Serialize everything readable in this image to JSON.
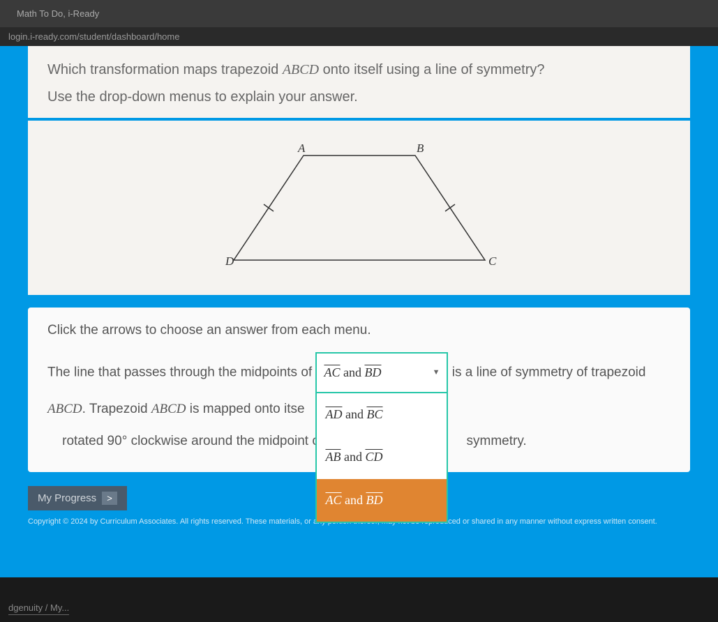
{
  "browser": {
    "tab_title": "Math To Do, i-Ready",
    "url": "login.i-ready.com/student/dashboard/home"
  },
  "question": {
    "line1_prefix": "Which transformation maps trapezoid ",
    "line1_math": "ABCD",
    "line1_suffix": " onto itself using a line of symmetry?",
    "line2": "Use the drop-down menus to explain your answer."
  },
  "diagram": {
    "labels": {
      "A": "A",
      "B": "B",
      "C": "C",
      "D": "D"
    }
  },
  "answer": {
    "instruction": "Click the arrows to choose an answer from each menu.",
    "text_part1": "The line that passes through the midpoints of ",
    "text_part2": " is a line of symmetry of trapezoid",
    "text_part3_math": "ABCD",
    "text_part3_suffix": ". Trapezoid ",
    "text_part3_math2": "ABCD",
    "text_part3_cont": " is mapped onto itse",
    "text_part4_prefix": "rotated 90° clockwise around the midpoint o",
    "text_part4_suffix": "symmetry.",
    "dropdown": {
      "selected": "AC and BD",
      "options": [
        {
          "seg1": "AD",
          "conj": " and ",
          "seg2": "BC",
          "highlighted": false
        },
        {
          "seg1": "AB",
          "conj": " and ",
          "seg2": "CD",
          "highlighted": false
        },
        {
          "seg1": "AC",
          "conj": " and ",
          "seg2": "BD",
          "highlighted": true
        }
      ]
    }
  },
  "progress_button": "My Progress",
  "copyright": "Copyright © 2024 by Curriculum Associates. All rights reserved. These materials, or any portion thereof, may not be reproduced or shared in any manner without express written consent.",
  "bottom_tab": "dgenuity / My..."
}
